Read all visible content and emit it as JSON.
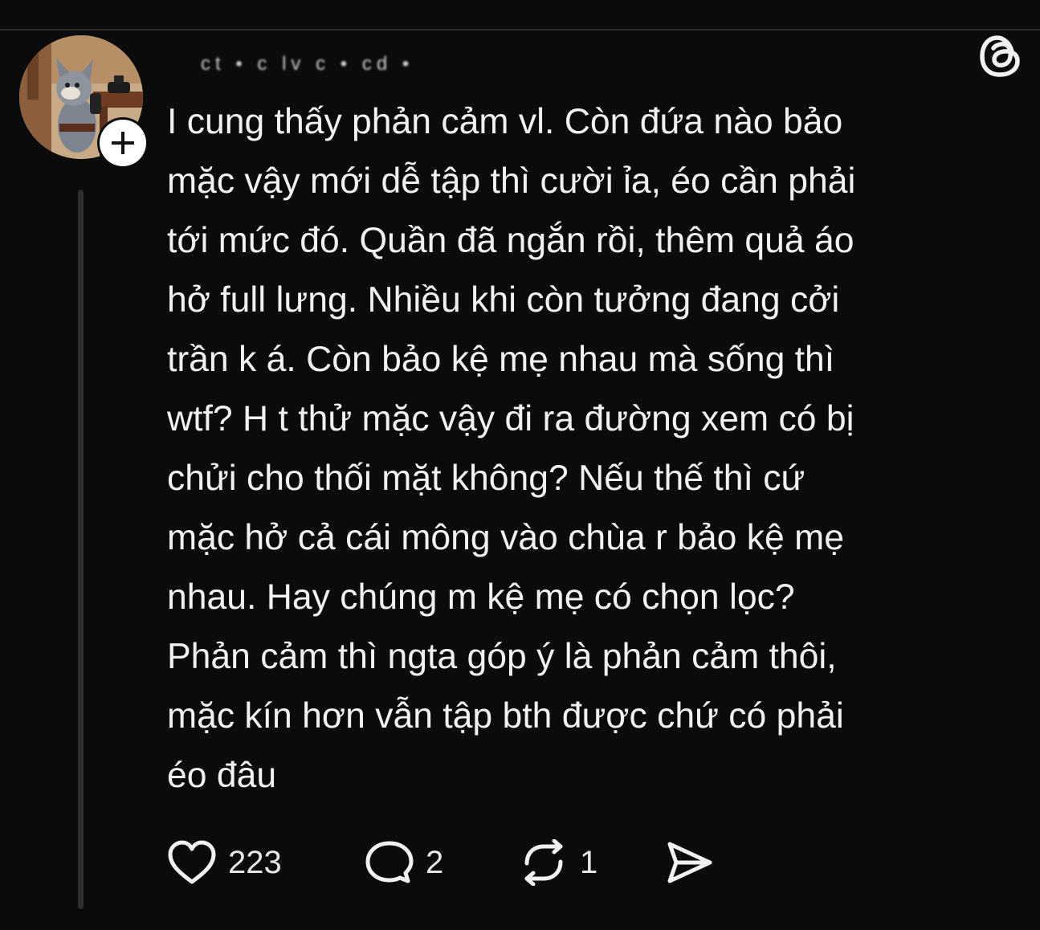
{
  "post": {
    "author_handle": "ct • c lv c • cd •",
    "lines": [
      "I  cung thấy phản cảm vl. Còn đứa nào bảo",
      "mặc vậy mới dễ tập thì cười ỉa, éo cần phải",
      "tới mức đó. Quần đã ngắn rồi, thêm quả áo",
      "hở full lưng. Nhiều khi còn tưởng đang cởi",
      "trần k á. Còn bảo kệ mẹ nhau mà sống thì",
      "wtf? H t thử mặc vậy đi ra đường xem có bị",
      "chửi cho thối mặt không? Nếu thế thì cứ",
      "mặc hở cả cái mông vào chùa r bảo kệ mẹ",
      "nhau. Hay chúng m kệ mẹ có chọn lọc?",
      "Phản cảm thì ngta góp ý là phản cảm thôi,",
      "mặc kín hơn vẫn tập bth được chứ có phải",
      "éo đâu"
    ]
  },
  "actions": {
    "likes": "223",
    "replies": "2",
    "reposts": "1"
  },
  "icons": {
    "avatar": "cartoon-cat-avatar",
    "follow": "plus-icon",
    "logo": "threads-logo-icon",
    "like": "heart-icon",
    "reply": "speech-bubble-icon",
    "repost": "repost-icon",
    "share": "send-icon"
  },
  "colors": {
    "background": "#0b0b0c",
    "text": "#f1f1f1",
    "thread_line": "#2e2e30"
  }
}
